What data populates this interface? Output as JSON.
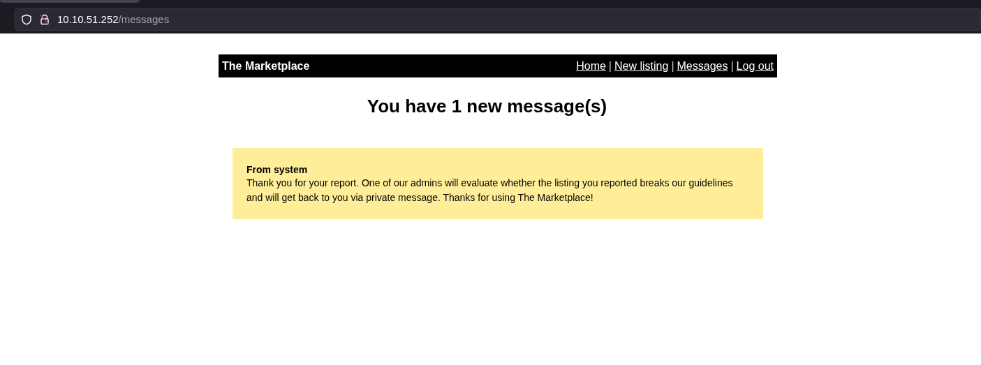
{
  "browser": {
    "address": {
      "host": "10.10.51.252",
      "path": "/messages"
    }
  },
  "navbar": {
    "brand": "The Marketplace",
    "items": [
      {
        "kind": "link",
        "label": "Home"
      },
      {
        "kind": "separator",
        "label": "|"
      },
      {
        "kind": "link",
        "label": "New listing"
      },
      {
        "kind": "separator",
        "label": "|"
      },
      {
        "kind": "link",
        "label": "Messages"
      },
      {
        "kind": "separator",
        "label": "|"
      },
      {
        "kind": "link",
        "label": "Log out"
      }
    ]
  },
  "heading": "You have 1 new message(s)",
  "messages": [
    {
      "sender": "From system",
      "body": "Thank you for your report. One of our admins will evaluate whether the listing you reported breaks our guidelines and will get back to you via private message. Thanks for using The Marketplace!"
    }
  ]
}
